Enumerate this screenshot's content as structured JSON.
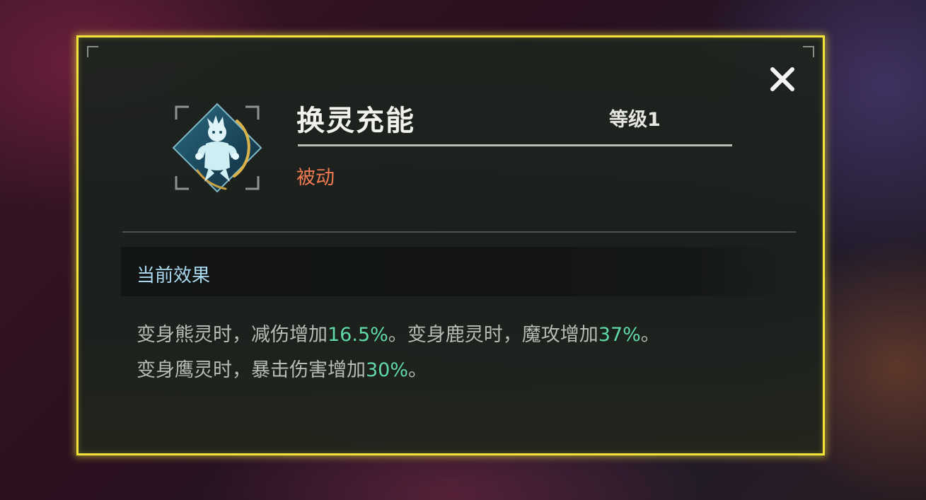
{
  "dialog": {
    "skill_name": "换灵充能",
    "level": "等级1",
    "skill_type": "被动",
    "section_title": "当前效果",
    "effect_line1": {
      "a": "变身熊灵时，减伤增加",
      "a_val": "16.5%",
      "b": "。变身鹿灵时，魔攻增加",
      "b_val": "37%",
      "c": "。"
    },
    "effect_line2": {
      "a": "变身鹰灵时，暴击伤害增加",
      "a_val": "30%",
      "b": "。"
    }
  },
  "icons": {
    "close": "close-icon",
    "skill": "bear-spirit-skill-icon"
  },
  "colors": {
    "border": "#f2e23a",
    "skill_type": "#f07a52",
    "section_title": "#a8d8ee",
    "highlight": "#5fd9a6"
  }
}
